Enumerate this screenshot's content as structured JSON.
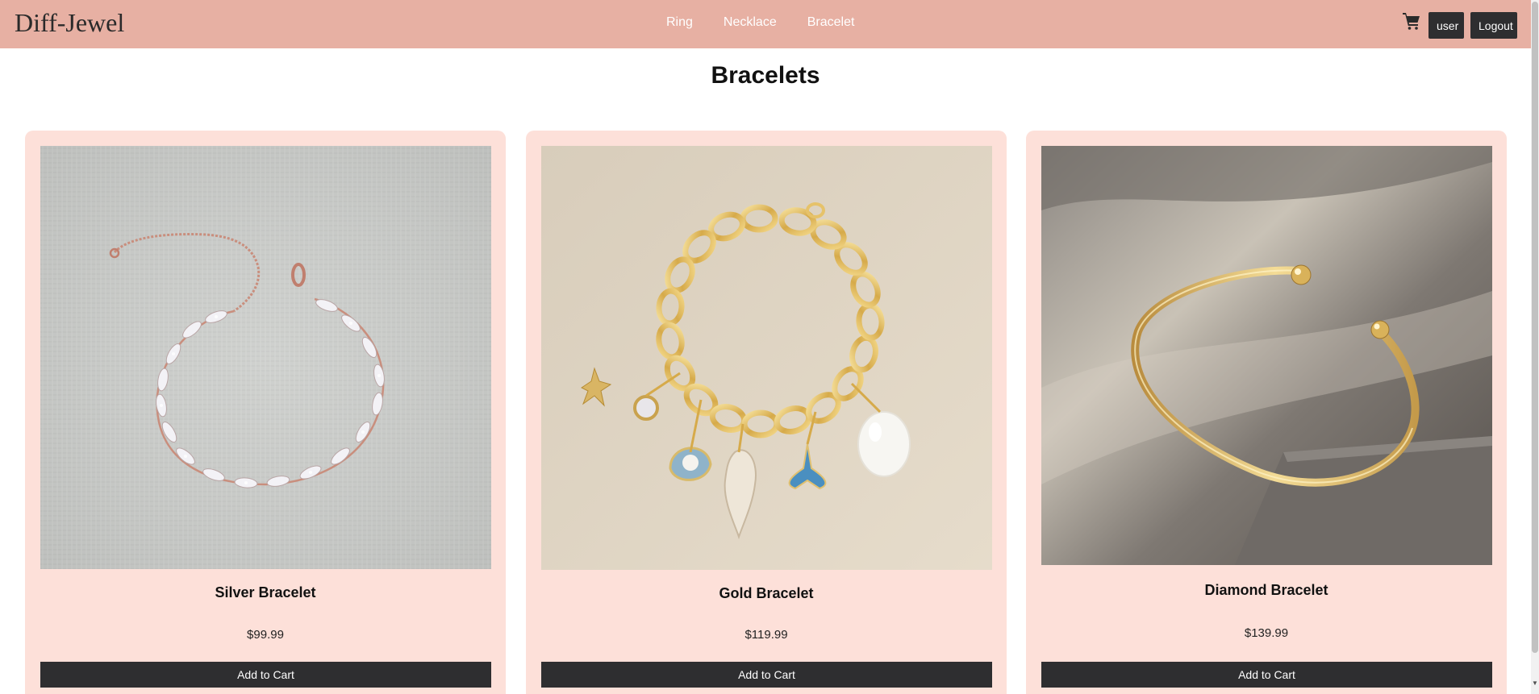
{
  "header": {
    "brand": "Diff-Jewel",
    "nav": [
      {
        "label": "Ring"
      },
      {
        "label": "Necklace"
      },
      {
        "label": "Bracelet"
      }
    ],
    "cart_icon": "shopping-cart-icon",
    "user_label": "user",
    "logout_label": "Logout"
  },
  "main": {
    "title": "Bracelets",
    "products": [
      {
        "name": "Silver Bracelet",
        "price": "$99.99",
        "button": "Add to Cart"
      },
      {
        "name": "Gold Bracelet",
        "price": "$119.99",
        "button": "Add to Cart"
      },
      {
        "name": "Diamond Bracelet",
        "price": "$139.99",
        "button": "Add to Cart"
      }
    ]
  },
  "colors": {
    "navbar": "#e7b0a3",
    "card": "#fde0d9",
    "button": "#2e2e30"
  }
}
